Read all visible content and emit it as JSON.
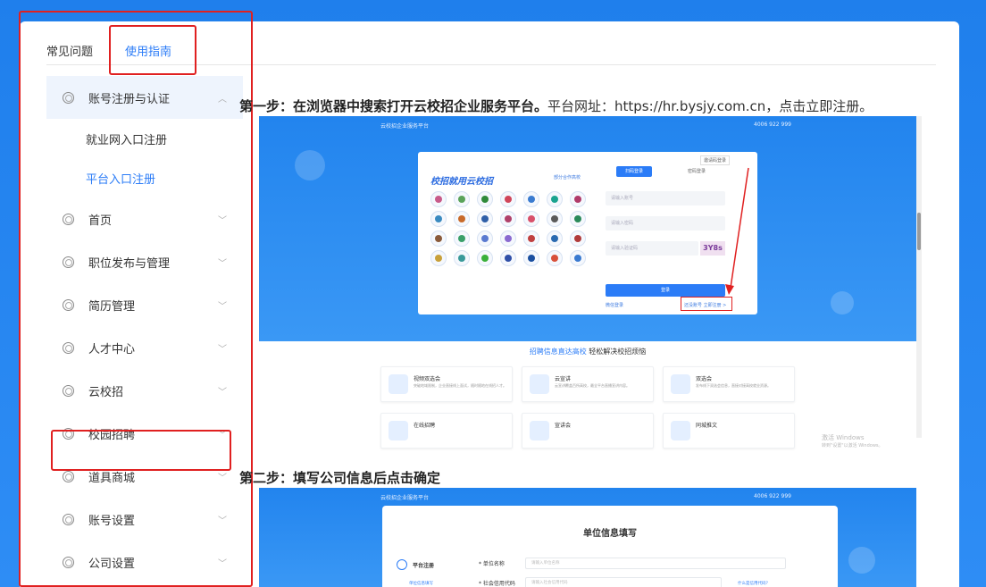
{
  "tabs": [
    {
      "label": "常见问题",
      "active": false
    },
    {
      "label": "使用指南",
      "active": true
    }
  ],
  "sidebar": {
    "items": [
      {
        "label": "账号注册与认证",
        "expanded": true,
        "children": [
          {
            "label": "就业网入口注册",
            "active": false
          },
          {
            "label": "平台入口注册",
            "active": true
          }
        ]
      },
      {
        "label": "首页"
      },
      {
        "label": "职位发布与管理"
      },
      {
        "label": "简历管理"
      },
      {
        "label": "人才中心"
      },
      {
        "label": "云校招"
      },
      {
        "label": "校园招聘"
      },
      {
        "label": "道具商城"
      },
      {
        "label": "账号设置"
      },
      {
        "label": "公司设置"
      }
    ]
  },
  "content": {
    "step1": {
      "bold": "第一步：在浏览器中搜索打开云校招企业服务平台。",
      "normal": "平台网址：https://hr.bysjy.com.cn，点击立即注册。"
    },
    "step2": {
      "bold": "第二步：填写公司信息后点击确定"
    }
  },
  "shot1": {
    "header_left": "云校招企业服务平台",
    "header_right": "4006 922 999",
    "panel_title": "校招就用云校招",
    "partner_link": "部分合作高校",
    "login_tab_1": "扫码登录",
    "login_tab_2": "密码登录",
    "scan_label": "邀请码登录",
    "field_1": "请输入账号",
    "field_2": "请输入密码",
    "field_3": "请输入验证码",
    "captcha": "3Y8s",
    "login_btn": "登录",
    "link_left": "微信登录",
    "link_right": "还没账号 立即注册 >",
    "bottom_title_hl": "招聘信息直达高校",
    "bottom_title": " 轻松解决校招烦恼",
    "features": [
      {
        "title": "视频双选会",
        "desc": "突破地域限制，企业直接线上面试，随时随地在线招人才。"
      },
      {
        "title": "云宣讲",
        "desc": "云宣讲覆盖百所高校，最全平台直播宣讲内容。"
      },
      {
        "title": "双选会",
        "desc": "发布线下双选会信息，直接对接高校就业资源。"
      },
      {
        "title": "在线招聘",
        "desc": ""
      },
      {
        "title": "宣讲会",
        "desc": ""
      },
      {
        "title": "同城推文",
        "desc": ""
      }
    ],
    "watermark_1": "激活 Windows",
    "watermark_2": "转到\"设置\"以激活 Windows。"
  },
  "shot2": {
    "header_left": "云校招企业服务平台",
    "header_right": "4006 922 999",
    "title": "单位信息填写",
    "radio_label": "平台注册",
    "sub_label": "单位信息填写",
    "field_1_label": "* 单位名称",
    "field_1_ph": "请输入单位名称",
    "field_2_label": "* 社会信用代码",
    "field_2_ph": "请输入社会信用代码",
    "field_2_hint": "什么是信用代码？"
  }
}
